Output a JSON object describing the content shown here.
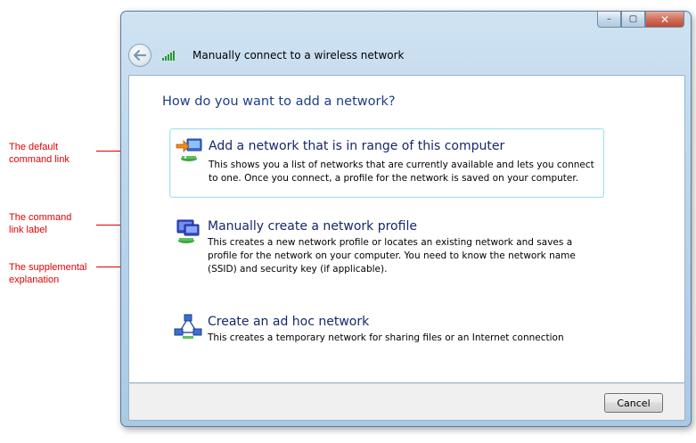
{
  "annotations": [
    {
      "line1": "The default",
      "line2": "command link"
    },
    {
      "line1": "The command",
      "line2": "link label"
    },
    {
      "line1": "The supplemental",
      "line2": "explanation"
    }
  ],
  "window": {
    "title": "Manually connect to a wireless network",
    "controls": {
      "minimize": "–",
      "maximize": "▢",
      "close": "✕"
    }
  },
  "main": {
    "heading": "How do you want to add a network?",
    "command_links": [
      {
        "label": "Add a network that is in range of this computer",
        "description": "This shows you a list of networks that are currently available and lets you connect to one. Once you connect, a profile for the network is saved on your computer.",
        "icon": "network-range-icon",
        "is_default": true
      },
      {
        "label": "Manually create a network profile",
        "description": "This creates a new network profile or locates an existing network and saves a profile for the network on your computer. You need to know the network name (SSID) and security key (if applicable).",
        "icon": "network-profile-icon",
        "is_default": false
      },
      {
        "label": "Create an ad hoc network",
        "description": "This creates a temporary network for sharing files or an Internet connection",
        "icon": "adhoc-network-icon",
        "is_default": false
      }
    ]
  },
  "footer": {
    "cancel_label": "Cancel"
  },
  "colors": {
    "annotation": "#e00000",
    "heading": "#1a3e8c",
    "link_label": "#14296b",
    "default_border": "#a8e2ef"
  }
}
